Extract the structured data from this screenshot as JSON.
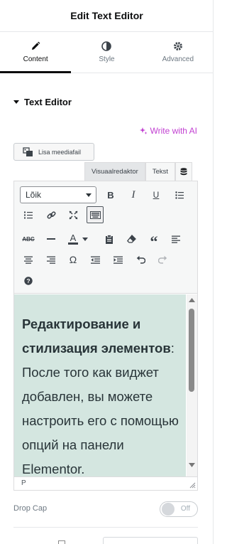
{
  "header": {
    "title": "Edit Text Editor"
  },
  "tabs": [
    {
      "label": "Content",
      "icon": "pencil-icon",
      "active": true
    },
    {
      "label": "Style",
      "icon": "contrast-icon",
      "active": false
    },
    {
      "label": "Advanced",
      "icon": "gear-icon",
      "active": false
    }
  ],
  "section": {
    "title": "Text Editor"
  },
  "ai": {
    "label": "Write with AI",
    "color": "#c13fd1"
  },
  "media": {
    "label": "Lisa meediafail"
  },
  "modes": {
    "visual": "Visuaalredaktor",
    "text": "Tekst"
  },
  "toolbar": {
    "format_select": "Lõik"
  },
  "content": {
    "bold_text": "Редактирование и стилизация элементов",
    "body_text": ": После того как виджет добавлен, вы можете настроить его с помощью опций на панели Elementor."
  },
  "statusbar": {
    "path": "P"
  },
  "dropcap": {
    "label": "Drop Cap",
    "toggle_label": "Off",
    "enabled": false
  },
  "colors": {
    "content_bg": "#d4e6e0",
    "accent": "#c13fd1"
  }
}
